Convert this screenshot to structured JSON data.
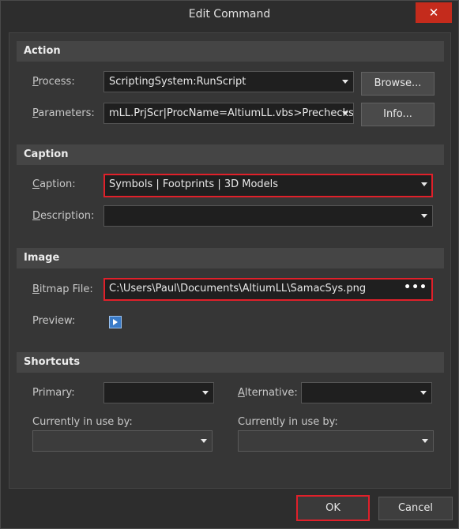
{
  "window": {
    "title": "Edit Command",
    "close_label": "✕"
  },
  "action": {
    "header": "Action",
    "process_label": "Process:",
    "process_value": "ScriptingSystem:RunScript",
    "browse_label": "Browse...",
    "parameters_label": "Parameters:",
    "parameters_value": "mLL.PrjScr|ProcName=AltiumLL.vbs>Prechecks",
    "info_label": "Info..."
  },
  "caption": {
    "header": "Caption",
    "caption_label": "Caption:",
    "caption_value": "Symbols | Footprints | 3D Models",
    "description_label": "Description:",
    "description_value": ""
  },
  "image": {
    "header": "Image",
    "bitmap_label": "Bitmap File:",
    "bitmap_value": "C:\\Users\\Paul\\Documents\\AltiumLL\\SamacSys.png",
    "dots_label": "•••",
    "preview_label": "Preview:"
  },
  "shortcuts": {
    "header": "Shortcuts",
    "primary_label": "Primary:",
    "primary_value": "",
    "alternative_label": "Alternative:",
    "alternative_value": "",
    "in_use_label_1": "Currently in use by:",
    "in_use_value_1": "",
    "in_use_label_2": "Currently in use by:",
    "in_use_value_2": ""
  },
  "footer": {
    "ok_label": "OK",
    "cancel_label": "Cancel"
  },
  "colors": {
    "highlight": "#e0202a",
    "close_button": "#c42b1c",
    "preview_icon": "#3a7bc8"
  }
}
